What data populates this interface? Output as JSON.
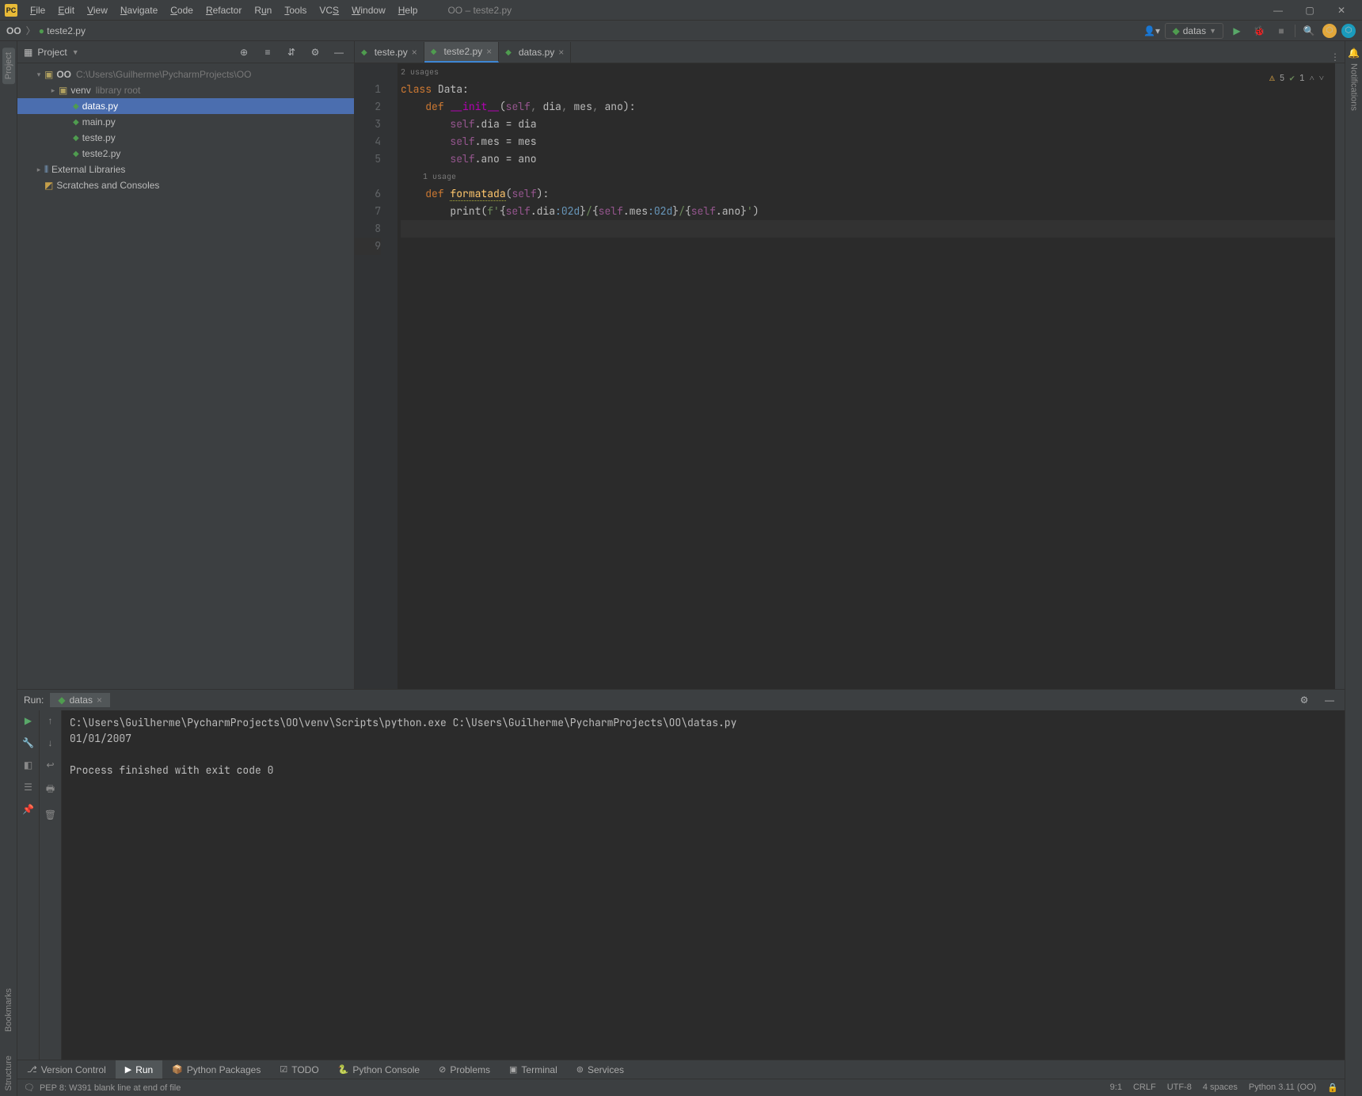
{
  "title": "OO – teste2.py",
  "menu": [
    "File",
    "Edit",
    "View",
    "Navigate",
    "Code",
    "Refactor",
    "Run",
    "Tools",
    "VCS",
    "Window",
    "Help"
  ],
  "breadcrumb": {
    "root": "OO",
    "file": "teste2.py"
  },
  "runConfig": {
    "name": "datas"
  },
  "projectHeader": "Project",
  "projectTree": {
    "root": {
      "name": "OO",
      "path": "C:\\Users\\Guilherme\\PycharmProjects\\OO"
    },
    "venv": {
      "name": "venv",
      "hint": "library root"
    },
    "files": [
      "datas.py",
      "main.py",
      "teste.py",
      "teste2.py"
    ],
    "extLib": "External Libraries",
    "scratches": "Scratches and Consoles"
  },
  "editorTabs": [
    {
      "name": "teste.py",
      "active": false
    },
    {
      "name": "teste2.py",
      "active": true
    },
    {
      "name": "datas.py",
      "active": false
    }
  ],
  "usageHints": {
    "class": "2 usages",
    "method": "1 usage"
  },
  "lineNumbers": [
    1,
    2,
    3,
    4,
    5,
    6,
    7,
    8,
    9
  ],
  "problems": {
    "warns": "5",
    "weak": "1"
  },
  "runPanel": {
    "title": "Run:",
    "tab": "datas",
    "lines": [
      "C:\\Users\\Guilherme\\PycharmProjects\\OO\\venv\\Scripts\\python.exe C:\\Users\\Guilherme\\PycharmProjects\\OO\\datas.py",
      "01/01/2007",
      "",
      "Process finished with exit code 0"
    ]
  },
  "toolWindows": {
    "vc": "Version Control",
    "run": "Run",
    "pkg": "Python Packages",
    "todo": "TODO",
    "console": "Python Console",
    "problems": "Problems",
    "terminal": "Terminal",
    "services": "Services"
  },
  "status": {
    "msg": "PEP 8: W391 blank line at end of file",
    "pos": "9:1",
    "sep": "CRLF",
    "enc": "UTF-8",
    "indent": "4 spaces",
    "sdk": "Python 3.11 (OO)"
  },
  "leftGutterTabs": {
    "project": "Project"
  },
  "lowerLeftTabs": {
    "bookmarks": "Bookmarks",
    "structure": "Structure"
  },
  "rightGutterTabs": {
    "notifications": "Notifications"
  }
}
